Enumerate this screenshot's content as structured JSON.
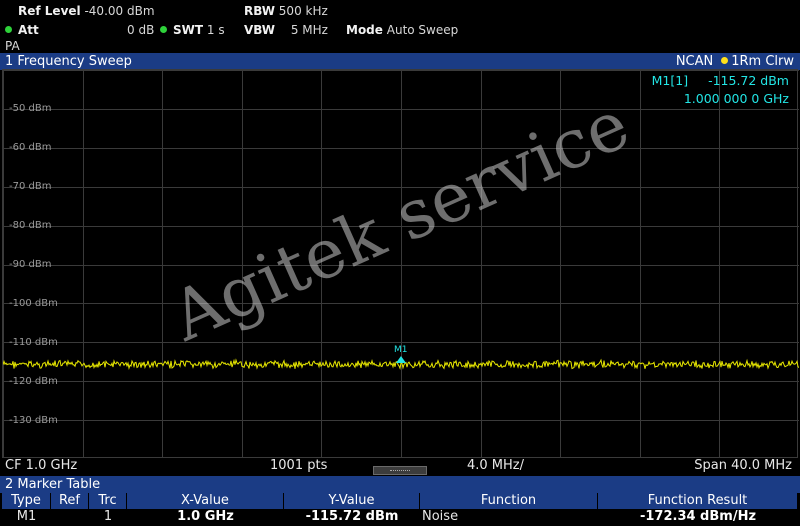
{
  "settings": {
    "ref_level_label": "Ref Level",
    "ref_level_value": "-40.00 dBm",
    "rbw_label": "RBW",
    "rbw_value": "500 kHz",
    "att_label": "Att",
    "att_value": "0 dB",
    "swt_label": "SWT",
    "swt_value": "1 s",
    "vbw_label": "VBW",
    "vbw_value": "5 MHz",
    "mode_label": "Mode",
    "mode_value": "Auto Sweep",
    "preamp": "PA"
  },
  "window": {
    "title": "1 Frequency Sweep",
    "ncan": "NCAN",
    "trace_info": "1Rm Clrw"
  },
  "marker_readout": {
    "label": "M1[1]",
    "level": "-115.72 dBm",
    "freq": "1.000 000 0 GHz"
  },
  "plot": {
    "y_labels": [
      "-50 dBm",
      "-60 dBm",
      "-70 dBm",
      "-80 dBm",
      "-90 dBm",
      "-100 dBm",
      "-110 dBm",
      "-120 dBm",
      "-130 dBm"
    ],
    "marker_tag": "M1",
    "watermark": "Agitek service",
    "trace_color": "#e8e800"
  },
  "infobar": {
    "cf": "CF 1.0 GHz",
    "points": "1001 pts",
    "div": "4.0 MHz/",
    "span": "Span 40.0 MHz"
  },
  "marker_table": {
    "title": "2 Marker Table",
    "headers": [
      "Type",
      "Ref",
      "Trc",
      "X-Value",
      "Y-Value",
      "Function",
      "Function Result"
    ],
    "row": [
      "M1",
      "",
      "1",
      "1.0 GHz",
      "-115.72 dBm",
      "Noise",
      "-172.34 dBm/Hz"
    ]
  }
}
